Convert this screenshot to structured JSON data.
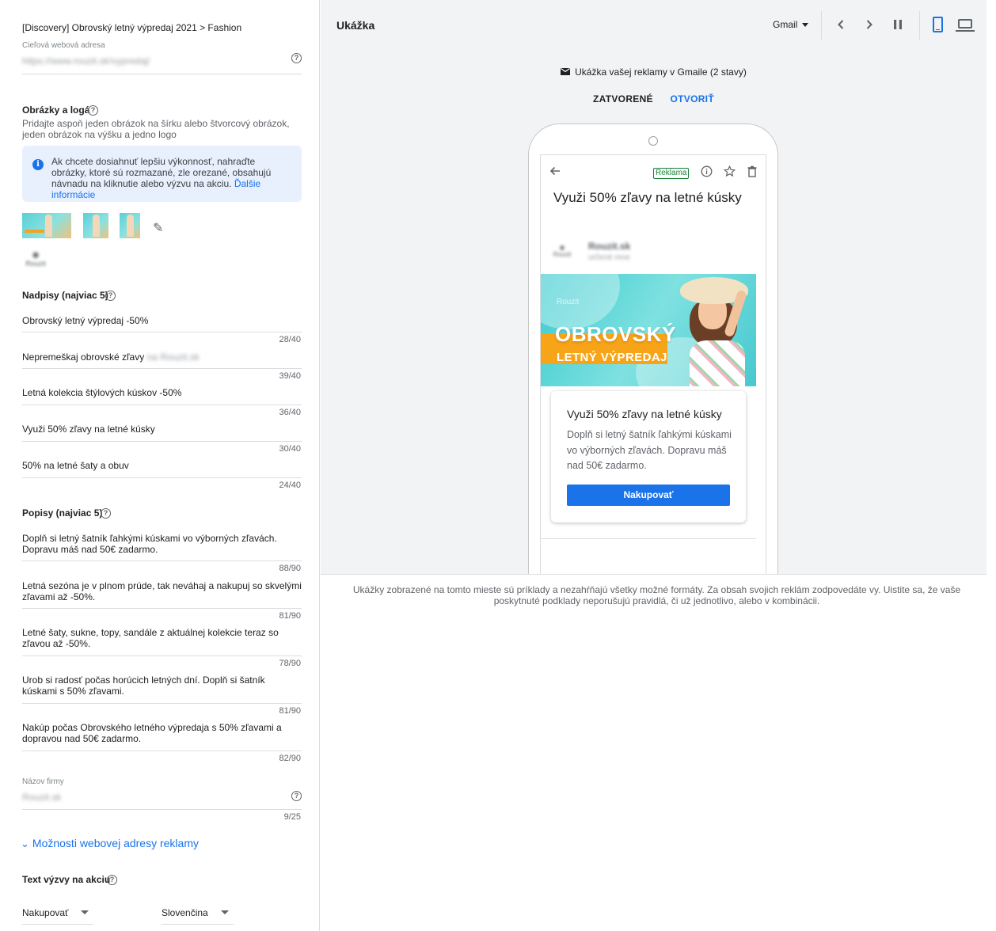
{
  "left": {
    "breadcrumb": "[Discovery] Obrovský letný výpredaj 2021 > Fashion",
    "url_label": "Cieľová webová adresa",
    "url_value": "https://www.rouzit.sk/vypredaj/",
    "images_title": "Obrázky a logá",
    "images_desc": "Pridajte aspoň jeden obrázok na šírku alebo štvorcový obrázok, jeden obrázok na výšku a jedno logo",
    "info_text": "Ak chcete dosiahnuť lepšiu výkonnosť, nahraďte obrázky, ktoré sú rozmazané, zle orezané, obsahujú návnadu na kliknutie alebo výzvu na akciu.",
    "info_link": "Ďalšie informácie",
    "logo_text": "Rouzit",
    "headlines_title": "Nadpisy (najviac 5)",
    "headlines": [
      {
        "text": "Obrovský letný výpredaj -50%",
        "counter": "28/40"
      },
      {
        "text": "Nepremeškaj obrovské zľavy",
        "blurred": "na Rouzit.sk",
        "counter": "39/40"
      },
      {
        "text": "Letná kolekcia štýlových kúskov -50%",
        "counter": "36/40"
      },
      {
        "text": "Využi 50% zľavy na letné kúsky",
        "counter": "30/40"
      },
      {
        "text": "50% na letné šaty a obuv",
        "counter": "24/40"
      }
    ],
    "descriptions_title": "Popisy (najviac 5)",
    "descriptions": [
      {
        "text": "Doplň si letný šatník ľahkými kúskami vo výborných zľavách. Dopravu máš nad 50€ zadarmo.",
        "counter": "88/90"
      },
      {
        "text": "Letná sezóna je v plnom prúde, tak neváhaj a nakupuj so skvelými zľavami až -50%.",
        "counter": "81/90"
      },
      {
        "text": "Letné šaty, sukne, topy, sandále z aktuálnej kolekcie teraz so zľavou až -50%.",
        "counter": "78/90"
      },
      {
        "text": "Urob si radosť počas horúcich letných dní. Doplň si šatník kúskami s 50% zľavami.",
        "counter": "81/90"
      },
      {
        "text": "Nakúp počas Obrovského letného výpredaja s 50% zľavami a dopravou nad 50€ zadarmo.",
        "counter": "82/90"
      }
    ],
    "business_label": "Názov firmy",
    "business_value": "Rouzit.sk",
    "business_counter": "9/25",
    "url_options": "Možnosti webovej adresy reklamy",
    "cta_title": "Text výzvy na akciu",
    "cta_value": "Nakupovať",
    "language_value": "Slovenčina"
  },
  "right": {
    "title": "Ukážka",
    "surface_select": "Gmail",
    "caption": "Ukážka vašej reklamy v Gmaile (2 stavy)",
    "tab_closed": "ZATVORENÉ",
    "tab_open": "OTVORIŤ",
    "ad_badge": "Reklama",
    "subject": "Využi 50% zľavy na letné kúsky",
    "sender_name": "Rouzit.sk",
    "sender_to": "určené mne",
    "sender_logo": "Rouzit",
    "banner_brand": "Rouzit",
    "banner_line1": "OBROVSKÝ",
    "banner_line2": "LETNÝ VÝPREDAJ",
    "card_title": "Využi 50% zľavy na letné kúsky",
    "card_desc": "Doplň si letný šatník ľahkými kúskami vo výborných zľavách. Dopravu máš nad 50€ zadarmo.",
    "cta": "Nakupovať",
    "disclaimer": "Ukážky zobrazené na tomto mieste sú príklady a nezahŕňajú všetky možné formáty. Za obsah svojich reklám zodpovedáte vy. Uistite sa, že vaše poskytnuté podklady neporušujú pravidlá, či už jednotlivo, alebo v kombinácii."
  },
  "colors": {
    "accent": "#1a73e8",
    "ad_badge": "#188038",
    "banner_teal": "#3ccbd0",
    "banner_orange": "#f8a419"
  },
  "icons": [
    "help-icon",
    "info-icon",
    "edit-pencil-icon",
    "chevron-down-icon",
    "prev-icon",
    "next-icon",
    "pause-icon",
    "mobile-device-icon",
    "desktop-device-icon",
    "mail-icon",
    "back-arrow-icon",
    "info-outline-icon",
    "star-icon",
    "delete-icon"
  ]
}
